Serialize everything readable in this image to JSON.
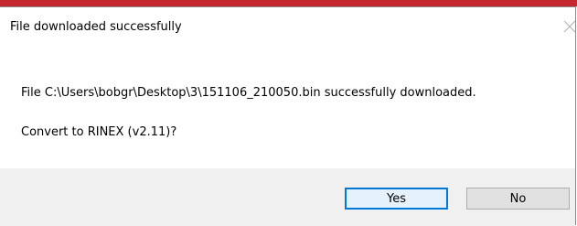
{
  "dialog": {
    "title": "File downloaded successfully",
    "message": "File C:\\Users\\bobgr\\Desktop\\3\\151106_210050.bin successfully downloaded.",
    "question": "Convert to RINEX (v2.11)?",
    "close_icon": "close-icon",
    "buttons": {
      "yes_label": "Yes",
      "no_label": "No"
    }
  },
  "colors": {
    "backdrop_accent": "#c6262e",
    "default_button_border": "#0078d7",
    "button_area": "#f0f0f0"
  }
}
